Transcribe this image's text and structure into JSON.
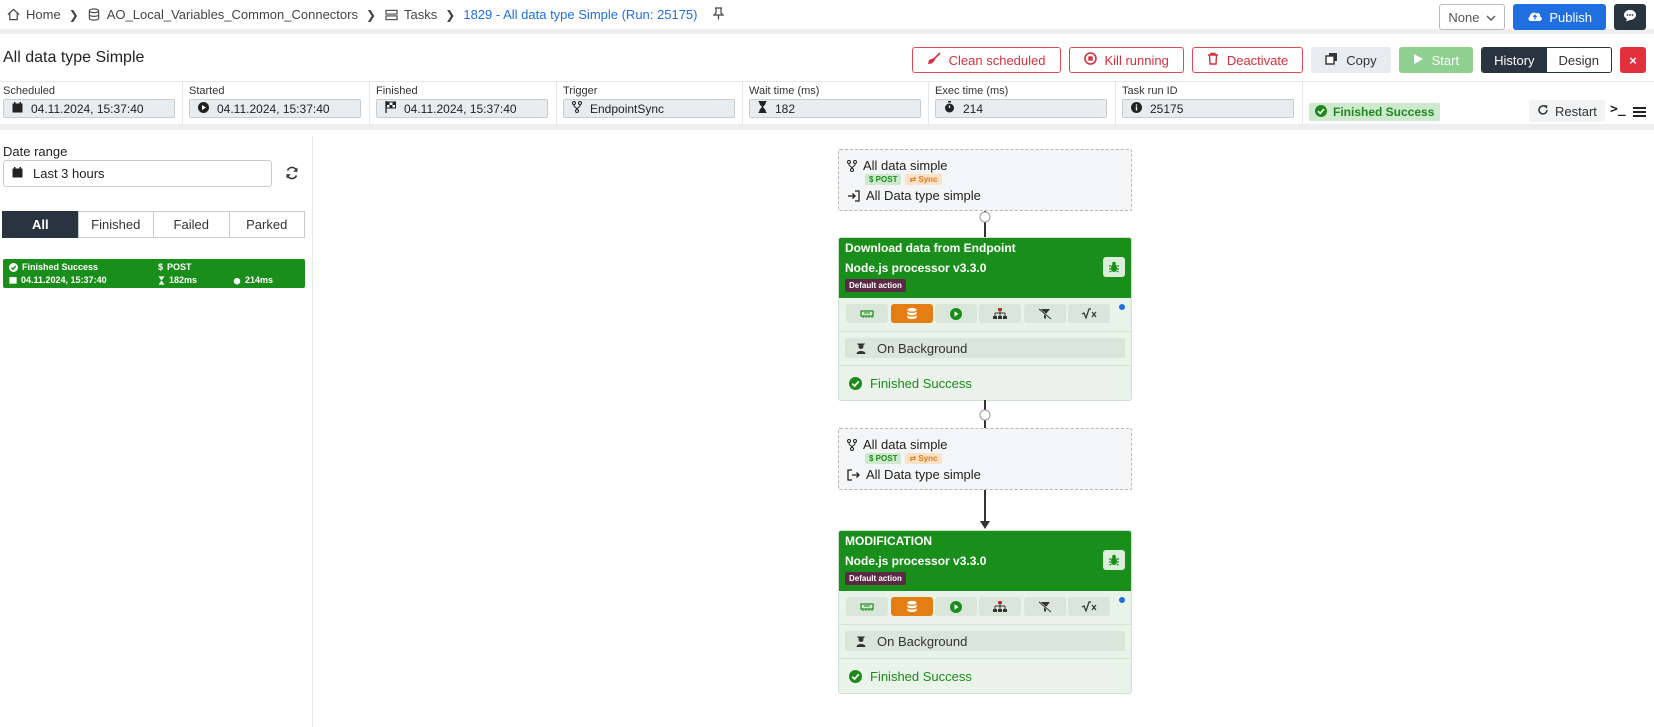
{
  "breadcrumb": {
    "home": "Home",
    "project": "AO_Local_Variables_Common_Connectors",
    "tasks": "Tasks",
    "current": "1829 - All data type Simple (Run: 25175)"
  },
  "top_right": {
    "select_value": "None",
    "publish_label": "Publish"
  },
  "page_title": "All data type Simple",
  "actions": {
    "clean_scheduled": "Clean scheduled",
    "kill_running": "Kill running",
    "deactivate": "Deactivate",
    "copy": "Copy",
    "start": "Start",
    "history": "History",
    "design": "Design",
    "close": "×"
  },
  "info": {
    "scheduled": {
      "label": "Scheduled",
      "value": "04.11.2024, 15:37:40"
    },
    "started": {
      "label": "Started",
      "value": "04.11.2024, 15:37:40"
    },
    "finished": {
      "label": "Finished",
      "value": "04.11.2024, 15:37:40"
    },
    "trigger": {
      "label": "Trigger",
      "value": "EndpointSync"
    },
    "wait_time": {
      "label": "Wait time (ms)",
      "value": "182"
    },
    "exec_time": {
      "label": "Exec time (ms)",
      "value": "214"
    },
    "task_run_id": {
      "label": "Task run ID",
      "value": "25175"
    },
    "status": "Finished Success",
    "restart": "Restart"
  },
  "left_panel": {
    "date_range_label": "Date range",
    "date_range_value": "Last 3 hours",
    "tabs": [
      "All",
      "Finished",
      "Failed",
      "Parked"
    ],
    "run": {
      "status": "Finished Success",
      "method": "POST",
      "date": "04.11.2024, 15:37:40",
      "wait": "182ms",
      "exec": "214ms"
    }
  },
  "flow": {
    "trigger_in": {
      "name": "All data simple",
      "method": "POST",
      "mode": "Sync",
      "task": "All Data type simple"
    },
    "proc1": {
      "name": "Download data from Endpoint",
      "processor": "Node.js processor v3.3.0",
      "action": "Default action",
      "background": "On Background",
      "status": "Finished Success"
    },
    "trigger_out": {
      "name": "All data simple",
      "method": "POST",
      "mode": "Sync",
      "task": "All Data type simple"
    },
    "proc2": {
      "name": "MODIFICATION",
      "processor": "Node.js processor v3.3.0",
      "action": "Default action",
      "background": "On Background",
      "status": "Finished Success"
    }
  },
  "colors": {
    "success_green": "#1a8e1a",
    "primary_blue": "#1f6fe0",
    "danger_red": "#e0313c",
    "dark": "#2a3340"
  }
}
